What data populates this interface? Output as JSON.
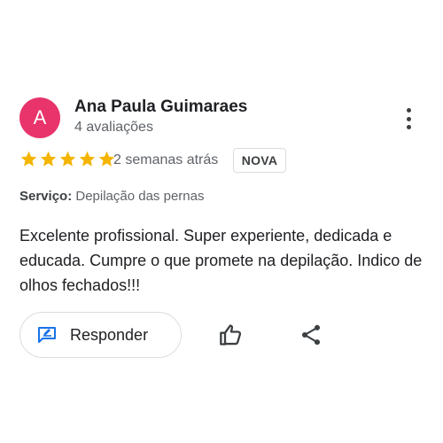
{
  "colors": {
    "avatar_bg": "#e8336b",
    "star": "#f4b400",
    "accent": "#1a73e8"
  },
  "reviewer": {
    "initial": "A",
    "name": "Ana Paula Guimaraes",
    "review_count": "4 avaliações"
  },
  "menu_icon": "more-vert-icon",
  "rating": {
    "stars": 5,
    "max": 5
  },
  "timestamp": "2 semanas atrás",
  "badge": "NOVA",
  "service": {
    "label": "Serviço:",
    "value": "Depilação das pernas"
  },
  "review_text": "Excelente profissional. Super experiente, dedicada e educada. Cumpre o que promete na depilação. Indico de olhos fechados!!!",
  "actions": {
    "reply_label": "Responder",
    "reply_icon": "reply-edit-icon",
    "like_icon": "thumb-up-icon",
    "share_icon": "share-icon"
  }
}
